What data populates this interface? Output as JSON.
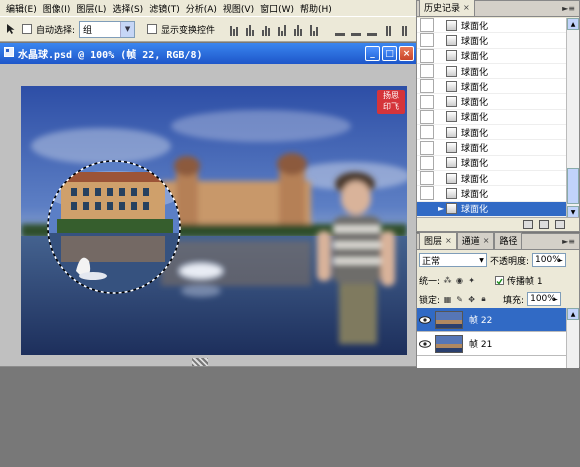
{
  "menu": [
    "编辑(E)",
    "图像(I)",
    "图层(L)",
    "选择(S)",
    "滤镜(T)",
    "分析(A)",
    "视图(V)",
    "窗口(W)",
    "帮助(H)"
  ],
  "options": {
    "auto_select_label": "自动选择:",
    "auto_select_value": "组",
    "show_transform_label": "显示变换控件"
  },
  "document": {
    "title": "水晶球.psd @ 100% (帧 22, RGB/8)",
    "watermark_line1": "扬思",
    "watermark_line2": "印飞"
  },
  "history": {
    "tab_label": "历史记录",
    "tab_close": "×",
    "items": [
      "球面化",
      "球面化",
      "球面化",
      "球面化",
      "球面化",
      "球面化",
      "球面化",
      "球面化",
      "球面化",
      "球面化",
      "球面化",
      "球面化",
      "球面化"
    ],
    "selected_index": 12
  },
  "layers": {
    "tabs": [
      {
        "label": "图层",
        "close": "×"
      },
      {
        "label": "通道",
        "close": "×"
      },
      {
        "label": "路径",
        "close": ""
      }
    ],
    "blend_mode": "正常",
    "opacity_label": "不透明度:",
    "opacity_value": "100%",
    "unify_label": "统一:",
    "propagate_label": "传播帧 1",
    "lock_label": "锁定:",
    "fill_label": "填充:",
    "fill_value": "100%",
    "items": [
      {
        "name": "帧 22",
        "selected": true
      },
      {
        "name": "帧 21",
        "selected": false
      }
    ]
  },
  "colors": {
    "title_bar": "#1e56c9",
    "selection": "#316ac5",
    "panel_bg": "#ece9d8",
    "workspace": "#787878"
  }
}
